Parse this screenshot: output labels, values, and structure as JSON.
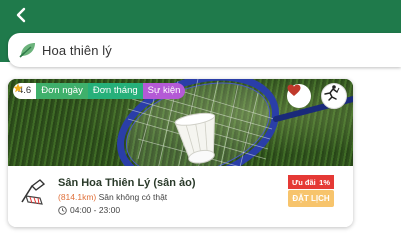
{
  "header": {
    "back_icon": "chevron-left-icon",
    "background_color": "#1f7a4b"
  },
  "search": {
    "value": "Hoa thiên lý",
    "icon": "leaf-icon"
  },
  "venue": {
    "rating": "4.6",
    "badges": {
      "day": "Đơn ngày",
      "month": "Đơn tháng",
      "event": "Sự kiện"
    },
    "name": "Sân Hoa Thiên Lý (sân ảo)",
    "distance": "(814.1km)",
    "note": "Sân không có thật",
    "hours": "04:00 - 23:00",
    "promo_label": "Ưu đãi",
    "promo_discount": "1%",
    "book_label": "ĐẶT LỊCH"
  },
  "colors": {
    "brand": "#1f7a4b",
    "badge_day": "#3fb06b",
    "badge_event": "#b45ad6",
    "promo": "#e53935",
    "book": "#f7c46c",
    "distance": "#e0703a"
  }
}
